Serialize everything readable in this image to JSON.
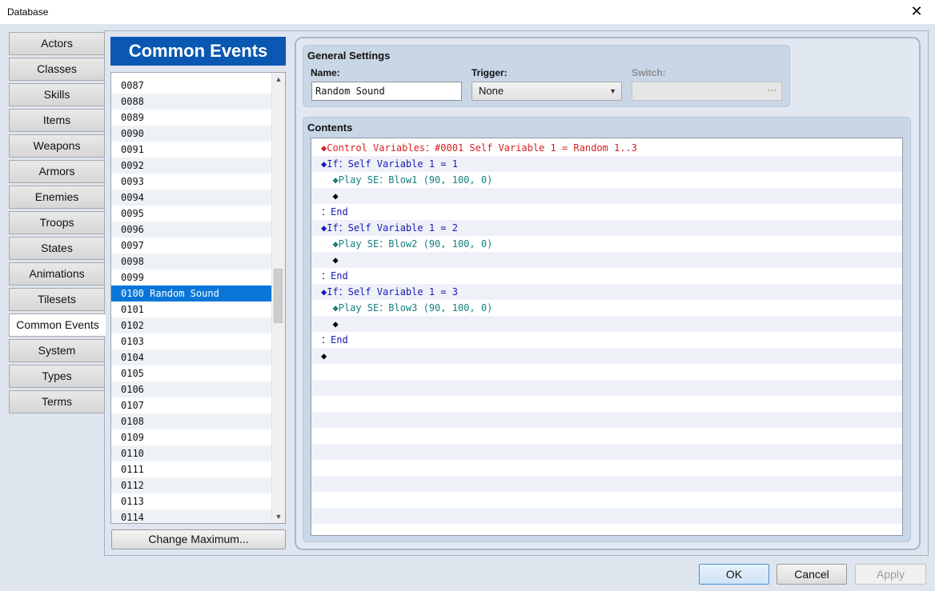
{
  "window": {
    "title": "Database",
    "close_glyph": "✕"
  },
  "tabs": [
    "Actors",
    "Classes",
    "Skills",
    "Items",
    "Weapons",
    "Armors",
    "Enemies",
    "Troops",
    "States",
    "Animations",
    "Tilesets",
    "Common Events",
    "System",
    "Types",
    "Terms"
  ],
  "active_tab": "Common Events",
  "list": {
    "header": "Common Events",
    "rows": [
      "0087",
      "0088",
      "0089",
      "0090",
      "0091",
      "0092",
      "0093",
      "0094",
      "0095",
      "0096",
      "0097",
      "0098",
      "0099",
      "0100 Random Sound",
      "0101",
      "0102",
      "0103",
      "0104",
      "0105",
      "0106",
      "0107",
      "0108",
      "0109",
      "0110",
      "0111",
      "0112",
      "0113",
      "0114"
    ],
    "selected_index": 13,
    "change_max_label": "Change Maximum..."
  },
  "general": {
    "title": "General Settings",
    "name_label": "Name:",
    "name_value": "Random Sound",
    "trigger_label": "Trigger:",
    "trigger_value": "None",
    "switch_label": "Switch:",
    "switch_button": "···"
  },
  "contents": {
    "title": "Contents",
    "commands": [
      {
        "text": "◆Control Variables：#0001 Self Variable 1 = Random 1..3",
        "color": "red"
      },
      {
        "text": "◆If：Self Variable 1 = 1",
        "color": "blue"
      },
      {
        "text": "  ◆Play SE：Blow1 (90, 100, 0)",
        "color": "teal"
      },
      {
        "text": "  ◆",
        "color": "black"
      },
      {
        "text": "：End",
        "color": "blue"
      },
      {
        "text": "◆If：Self Variable 1 = 2",
        "color": "blue"
      },
      {
        "text": "  ◆Play SE：Blow2 (90, 100, 0)",
        "color": "teal"
      },
      {
        "text": "  ◆",
        "color": "black"
      },
      {
        "text": "：End",
        "color": "blue"
      },
      {
        "text": "◆If：Self Variable 1 = 3",
        "color": "blue"
      },
      {
        "text": "  ◆Play SE：Blow3 (90, 100, 0)",
        "color": "teal"
      },
      {
        "text": "  ◆",
        "color": "black"
      },
      {
        "text": "：End",
        "color": "blue"
      },
      {
        "text": "◆",
        "color": "black"
      }
    ],
    "total_rows": 25
  },
  "buttons": {
    "ok": "OK",
    "cancel": "Cancel",
    "apply": "Apply"
  },
  "icons": {
    "close": "close-icon",
    "scroll_up": "scroll-up-icon",
    "scroll_down": "scroll-down-icon",
    "dropdown": "chevron-down-icon"
  },
  "colors": {
    "header_blue": "#0a58b2",
    "selection_blue": "#0a76d8",
    "cmd_red": "#d42020",
    "cmd_blue": "#1818b8",
    "cmd_teal": "#168080"
  }
}
